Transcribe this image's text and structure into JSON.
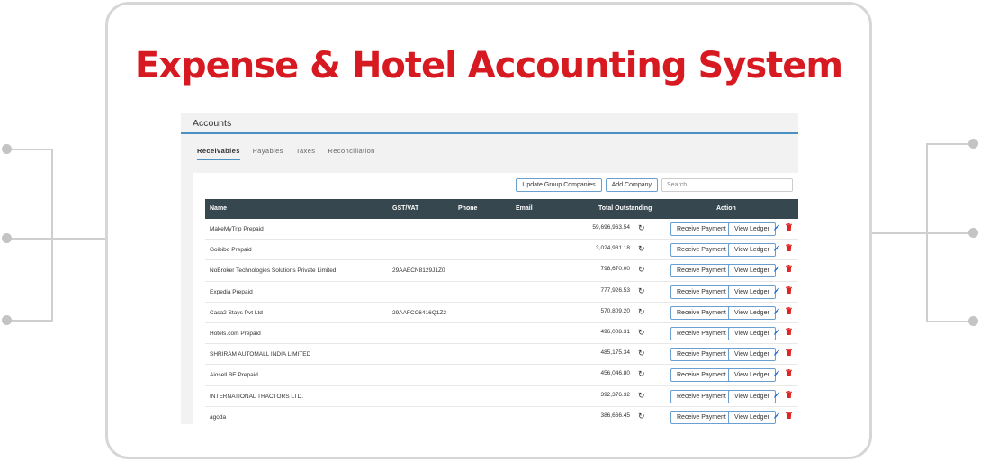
{
  "hero_title": "Expense & Hotel Accounting System",
  "app": {
    "title": "Accounts",
    "tabs": [
      {
        "label": "Receivables",
        "active": true
      },
      {
        "label": "Payables",
        "active": false
      },
      {
        "label": "Taxes",
        "active": false
      },
      {
        "label": "Reconciliation",
        "active": false
      }
    ],
    "toolbar": {
      "update_label": "Update Group Companies",
      "add_label": "Add Company",
      "search_placeholder": "Search..."
    },
    "table": {
      "headers": {
        "name": "Name",
        "gst": "GST/VAT",
        "phone": "Phone",
        "email": "Email",
        "total": "Total Outstanding",
        "action": "Action"
      },
      "receive_label": "Receive Payment",
      "ledger_label": "View Ledger",
      "rows": [
        {
          "name": "MakeMyTrip Prepaid",
          "gst": "",
          "phone": "",
          "email": "",
          "total": "59,696,963.54"
        },
        {
          "name": "Goibibo Prepaid",
          "gst": "",
          "phone": "",
          "email": "",
          "total": "3,024,981.18"
        },
        {
          "name": "NoBroker Technologies Solutions Private Limited",
          "gst": "29AAECN8129J1Z0",
          "phone": "",
          "email": "",
          "total": "798,670.00"
        },
        {
          "name": "Expedia Prepaid",
          "gst": "",
          "phone": "",
          "email": "",
          "total": "777,926.53"
        },
        {
          "name": "Casa2 Stays Pvt Ltd",
          "gst": "29AAFCC6416Q1Z2",
          "phone": "",
          "email": "",
          "total": "570,809.20"
        },
        {
          "name": "Hotels.com Prepaid",
          "gst": "",
          "phone": "",
          "email": "",
          "total": "496,008.31"
        },
        {
          "name": "SHRIRAM AUTOMALL INDIA LIMITED",
          "gst": "",
          "phone": "",
          "email": "",
          "total": "485,175.34"
        },
        {
          "name": "Aiosell BE Prepaid",
          "gst": "",
          "phone": "",
          "email": "",
          "total": "456,046.80"
        },
        {
          "name": "INTERNATIONAL TRACTORS LTD.",
          "gst": "",
          "phone": "",
          "email": "",
          "total": "392,376.32"
        },
        {
          "name": "agoda",
          "gst": "",
          "phone": "",
          "email": "",
          "total": "386,666.45"
        }
      ]
    }
  },
  "colors": {
    "brand_red": "#d71a21",
    "header_dark": "#37474f",
    "accent_blue": "#4a90c2",
    "edit_blue": "#1e6fd0",
    "delete_red": "#e02424"
  },
  "icons": {
    "refresh": "refresh-icon",
    "edit": "pencil-icon",
    "delete": "trash-icon"
  }
}
